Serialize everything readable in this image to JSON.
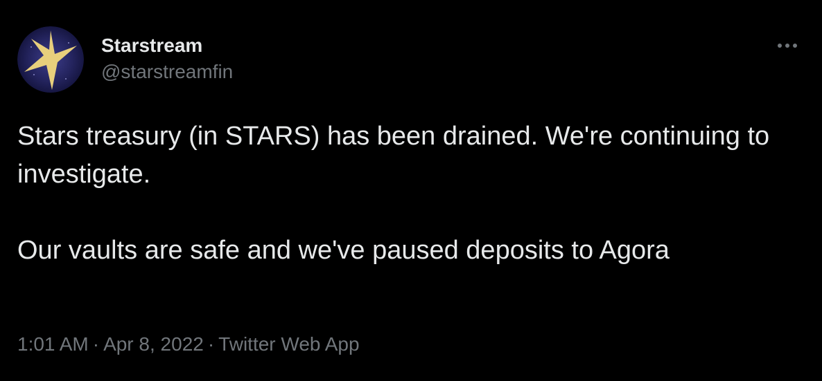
{
  "author": {
    "display_name": "Starstream",
    "handle": "@starstreamfin",
    "avatar_icon": "star-logo-icon"
  },
  "tweet": {
    "paragraphs": [
      "Stars treasury (in STARS) has been drained. We're continuing to investigate.",
      "Our vaults are safe and we've paused deposits to Agora"
    ]
  },
  "meta": {
    "time": "1:01 AM",
    "separator": "·",
    "date": "Apr 8, 2022",
    "source": "Twitter Web App"
  },
  "more_icon": "more-horizontal-icon",
  "colors": {
    "background": "#000000",
    "text_primary": "#e7e9ea",
    "text_secondary": "#71767b",
    "star_gold": "#e8cf7c"
  }
}
